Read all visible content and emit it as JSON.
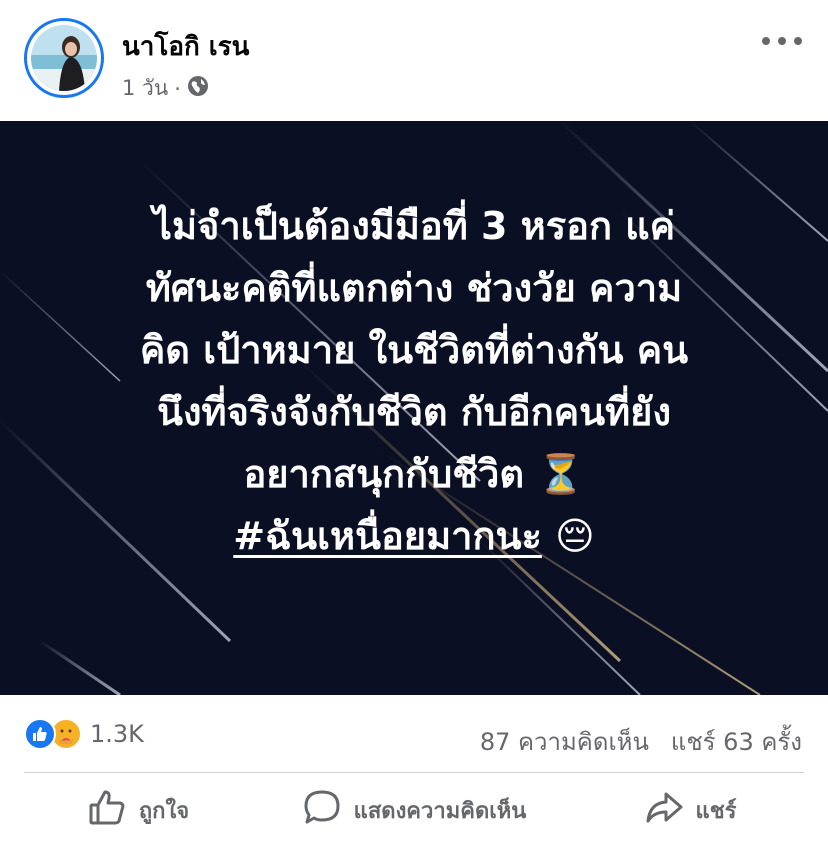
{
  "post": {
    "author": "นาโอกิ เรน",
    "time": "1 วัน",
    "separator": "·",
    "privacy_icon": "globe-icon"
  },
  "image_text": {
    "lines": [
      "ไม่จำเป็นต้องมีมือที่ 3 หรอก แค่",
      "ทัศนะคติที่แตกต่าง ช่วงวัย ความ",
      "คิด เป้าหมาย ในชีวิตที่ต่างกัน คน",
      "นึงที่จริงจังกับชีวิต กับอีกคนที่ยัง",
      "อยากสนุกกับชีวิต ⏳"
    ],
    "hashtag": "#ฉันเหนื่อยมากนะ",
    "hashtag_emoji": "😔"
  },
  "stats": {
    "reaction_count": "1.3K",
    "comments": "87 ความคิดเห็น",
    "shares": "แชร์ 63 ครั้ง",
    "reaction_icons": [
      "like-icon",
      "care-icon"
    ]
  },
  "actions": {
    "like": "ถูกใจ",
    "comment": "แสดงความคิดเห็น",
    "share": "แชร์"
  },
  "colors": {
    "accent": "#1877f2",
    "secondary_text": "#65676b",
    "image_bg": "#0b0f24"
  }
}
